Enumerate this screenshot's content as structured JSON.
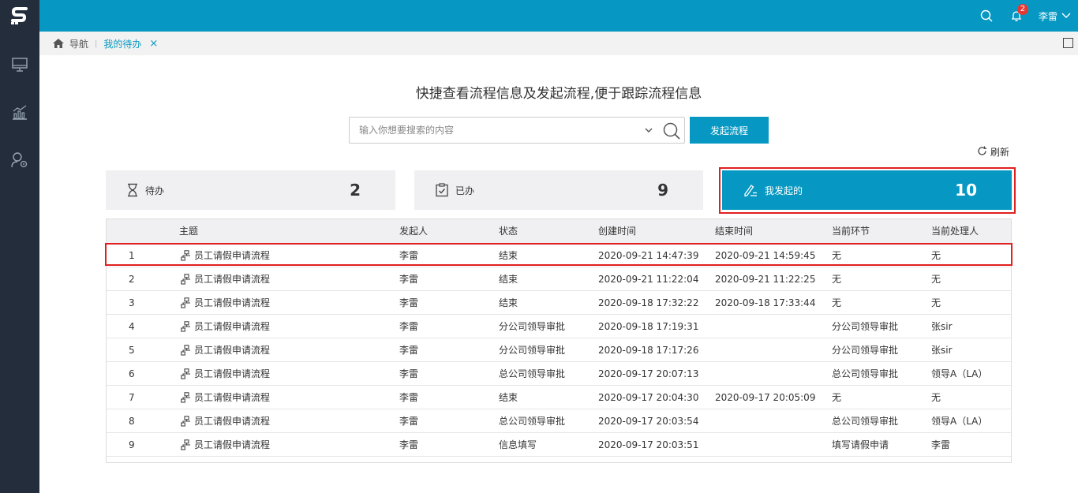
{
  "header": {
    "user_name": "李雷",
    "notification_count": "2",
    "icons": [
      "search-icon",
      "bell-icon",
      "chevron-down-icon"
    ]
  },
  "sidebar": {
    "items": [
      {
        "icon": "monitor-icon"
      },
      {
        "icon": "bar-chart-icon"
      },
      {
        "icon": "user-settings-icon"
      }
    ]
  },
  "breadcrumb": {
    "nav_label": "导航",
    "tab_label": "我的待办",
    "close_glyph": "×"
  },
  "main": {
    "headline": "快捷查看流程信息及发起流程,便于跟踪流程信息",
    "search_placeholder": "输入你想要搜索的内容",
    "start_button": "发起流程",
    "refresh_label": "刷新"
  },
  "cards": [
    {
      "label": "待办",
      "count": "2",
      "icon": "hourglass-icon",
      "active": false
    },
    {
      "label": "已办",
      "count": "9",
      "icon": "clipboard-check-icon",
      "active": false
    },
    {
      "label": "我发起的",
      "count": "10",
      "icon": "pen-edit-icon",
      "active": true
    }
  ],
  "table": {
    "columns": [
      "主题",
      "发起人",
      "状态",
      "创建时间",
      "结束时间",
      "当前环节",
      "当前处理人"
    ],
    "rows": [
      {
        "no": "1",
        "subject": "员工请假申请流程",
        "initiator": "李雷",
        "status": "结束",
        "created": "2020-09-21 14:47:39",
        "ended": "2020-09-21 14:59:45",
        "step": "无",
        "handler": "无"
      },
      {
        "no": "2",
        "subject": "员工请假申请流程",
        "initiator": "李雷",
        "status": "结束",
        "created": "2020-09-21 11:22:04",
        "ended": "2020-09-21 11:22:25",
        "step": "无",
        "handler": "无"
      },
      {
        "no": "3",
        "subject": "员工请假申请流程",
        "initiator": "李雷",
        "status": "结束",
        "created": "2020-09-18 17:32:22",
        "ended": "2020-09-18 17:33:44",
        "step": "无",
        "handler": "无"
      },
      {
        "no": "4",
        "subject": "员工请假申请流程",
        "initiator": "李雷",
        "status": "分公司领导审批",
        "created": "2020-09-18 17:19:31",
        "ended": "",
        "step": "分公司领导审批",
        "handler": "张sir"
      },
      {
        "no": "5",
        "subject": "员工请假申请流程",
        "initiator": "李雷",
        "status": "分公司领导审批",
        "created": "2020-09-18 17:17:26",
        "ended": "",
        "step": "分公司领导审批",
        "handler": "张sir"
      },
      {
        "no": "6",
        "subject": "员工请假申请流程",
        "initiator": "李雷",
        "status": "总公司领导审批",
        "created": "2020-09-17 20:07:13",
        "ended": "",
        "step": "总公司领导审批",
        "handler": "领导A（LA）"
      },
      {
        "no": "7",
        "subject": "员工请假申请流程",
        "initiator": "李雷",
        "status": "结束",
        "created": "2020-09-17 20:04:30",
        "ended": "2020-09-17 20:05:09",
        "step": "无",
        "handler": "无"
      },
      {
        "no": "8",
        "subject": "员工请假申请流程",
        "initiator": "李雷",
        "status": "总公司领导审批",
        "created": "2020-09-17 20:03:54",
        "ended": "",
        "step": "总公司领导审批",
        "handler": "领导A（LA）"
      },
      {
        "no": "9",
        "subject": "员工请假申请流程",
        "initiator": "李雷",
        "status": "信息填写",
        "created": "2020-09-17 20:03:51",
        "ended": "",
        "step": "填写请假申请",
        "handler": "李雷"
      }
    ]
  },
  "colors": {
    "accent": "#0698c2",
    "sidebar": "#232d3b",
    "highlight": "#e02020"
  }
}
